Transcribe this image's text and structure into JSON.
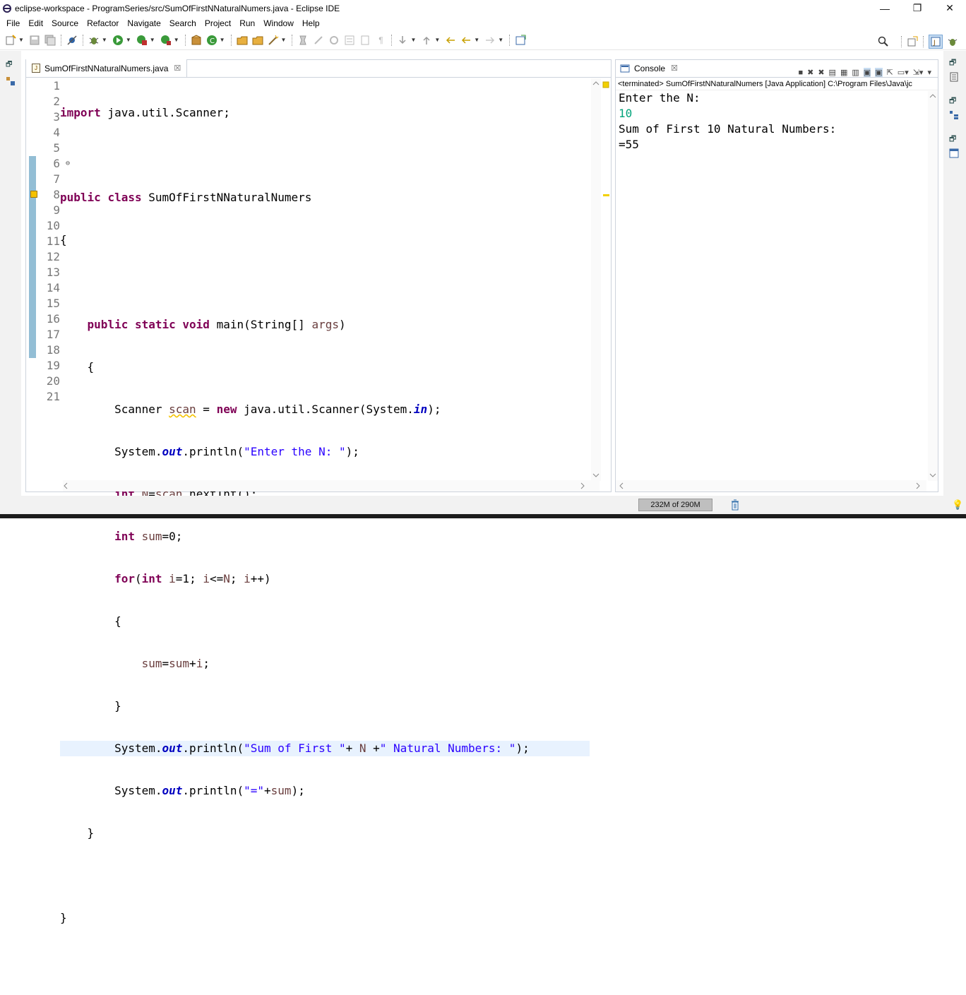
{
  "window": {
    "title": "eclipse-workspace - ProgramSeries/src/SumOfFirstNNaturalNumers.java - Eclipse IDE",
    "minimize": "—",
    "restore": "❐",
    "close": "✕"
  },
  "menu": [
    "File",
    "Edit",
    "Source",
    "Refactor",
    "Navigate",
    "Search",
    "Project",
    "Run",
    "Window",
    "Help"
  ],
  "editor": {
    "tab_label": "SumOfFirstNNaturalNumers.java",
    "line_numbers": [
      "1",
      "2",
      "3",
      "4",
      "5",
      "6",
      "7",
      "8",
      "9",
      "10",
      "11",
      "12",
      "13",
      "14",
      "15",
      "16",
      "17",
      "18",
      "19",
      "20",
      "21"
    ],
    "fold_marker": "⊖",
    "current_line": 16
  },
  "console": {
    "tab_label": "Console",
    "header": "<terminated> SumOfFirstNNaturalNumers [Java Application] C:\\Program Files\\Java\\jc",
    "output": [
      "Enter the N:",
      "10",
      "Sum of First 10 Natural Numbers:",
      "=55"
    ]
  },
  "status": {
    "heap": "232M of 290M"
  },
  "colors": {
    "keyword": "#7f0055",
    "string": "#2a00ff",
    "field": "#0000c0",
    "console_input": "#00a37a",
    "current_line_bg": "#e8f2fe"
  }
}
